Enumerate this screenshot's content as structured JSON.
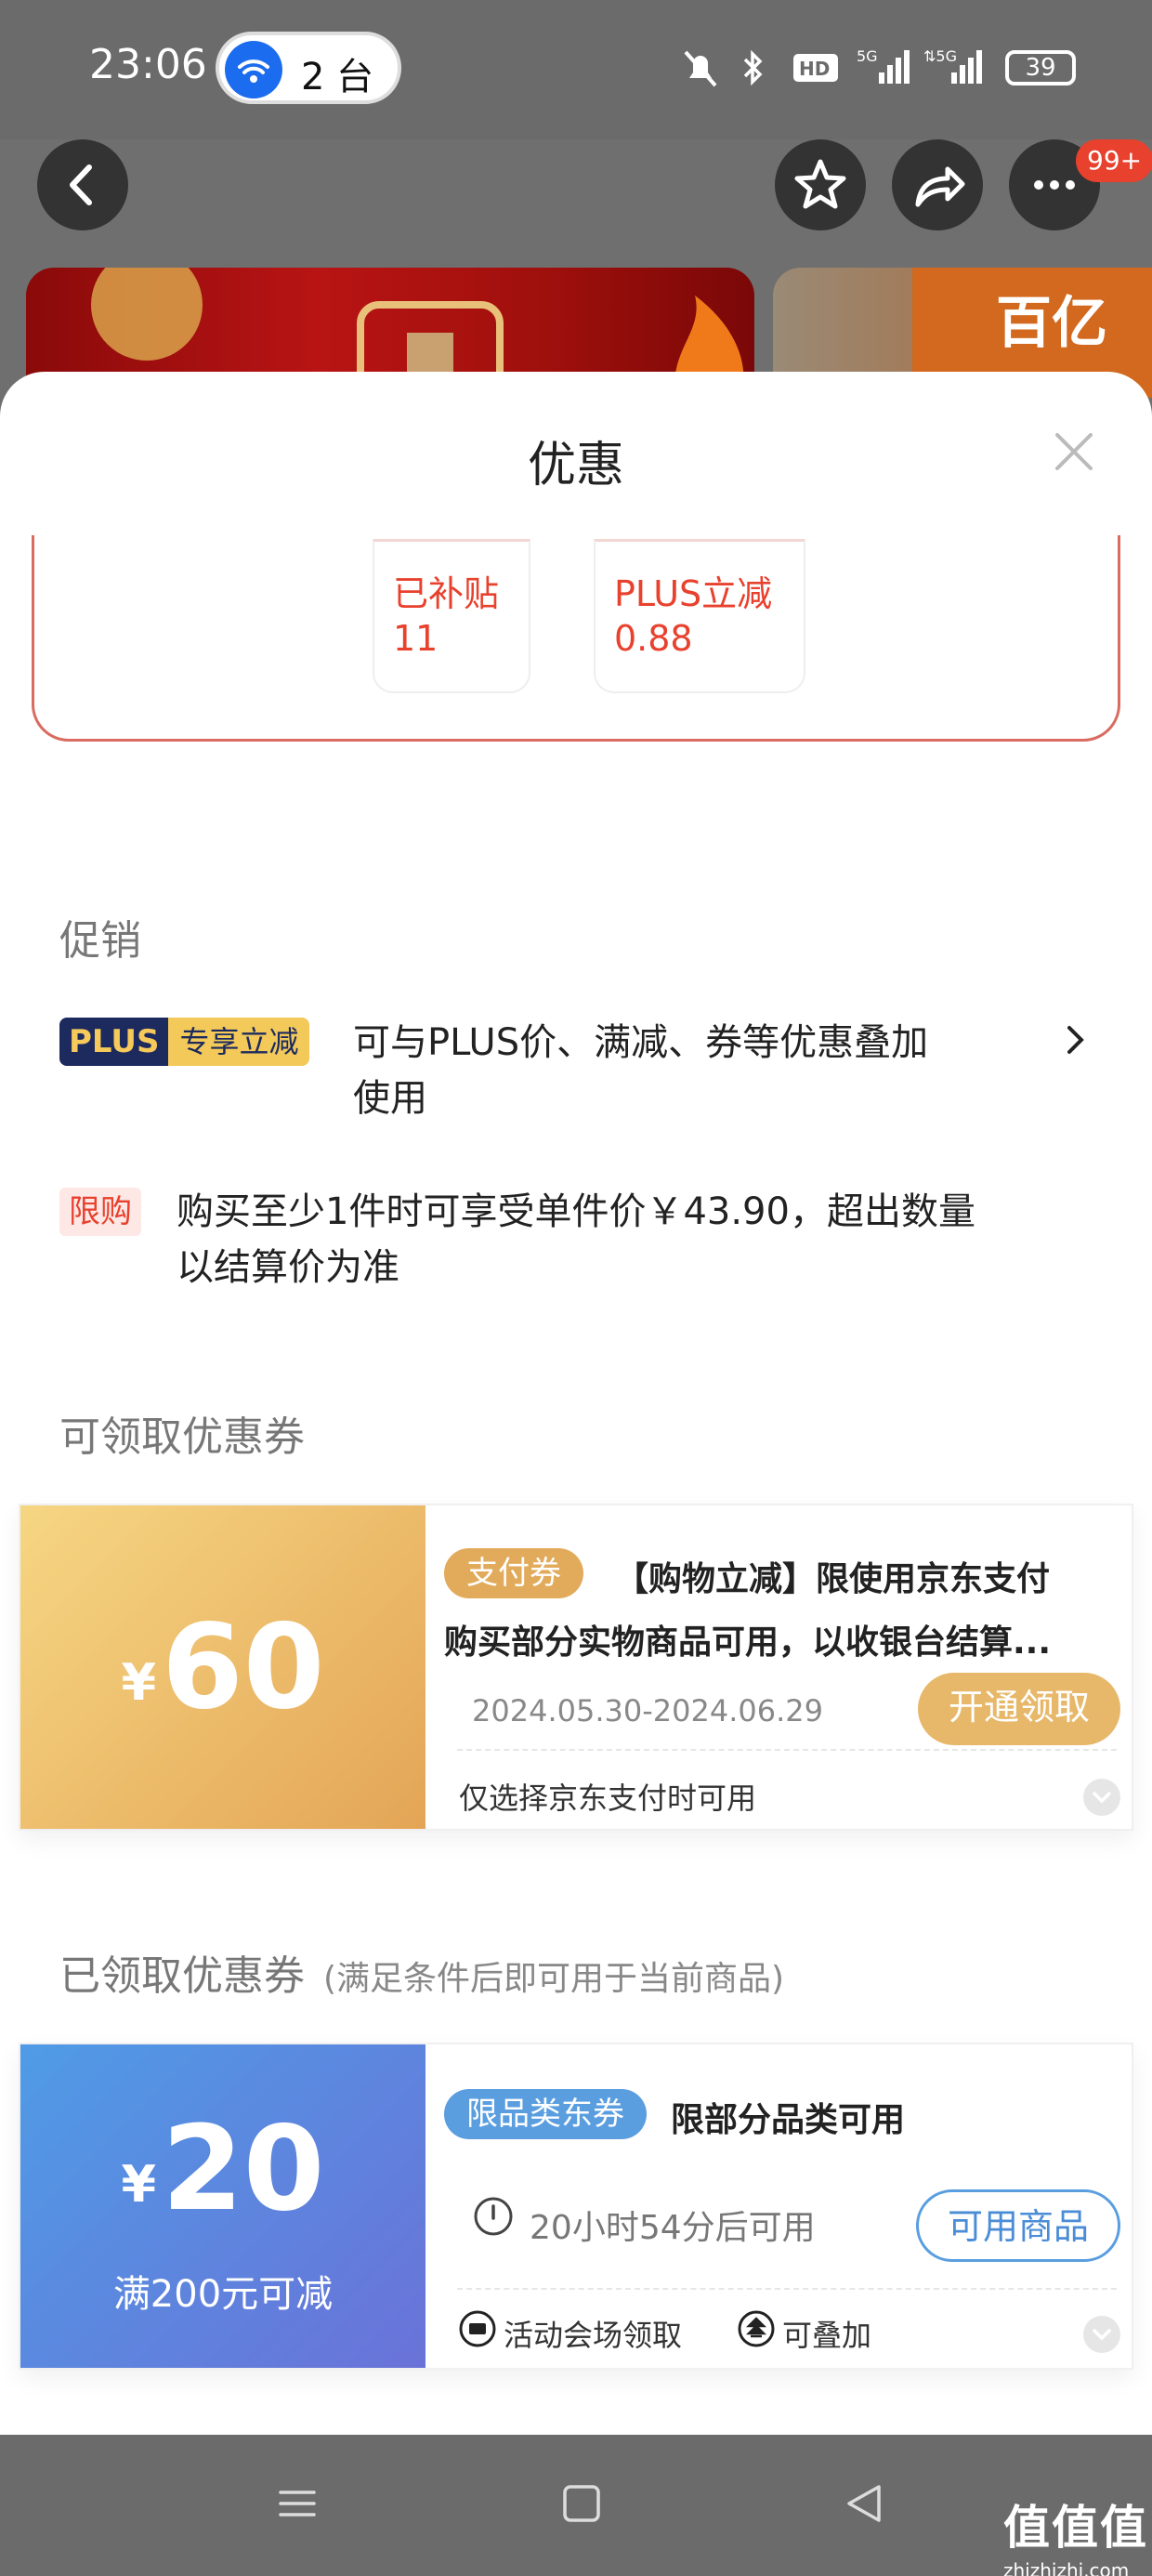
{
  "status_bar": {
    "time": "23:06",
    "hotspot_label": "2 台",
    "battery": "39"
  },
  "header": {
    "more_badge": "99+"
  },
  "sheet": {
    "title": "优惠",
    "price_chips": [
      {
        "line1": "已补贴",
        "line2": "11"
      },
      {
        "line1": "PLUS立减",
        "line2": "0.88"
      }
    ]
  },
  "promotions": {
    "heading": "促销",
    "plus": {
      "tag_a": "PLUS",
      "tag_b": "专享立减",
      "line1": "可与PLUS价、满减、券等优惠叠加",
      "line2": "使用"
    },
    "limit": {
      "tag": "限购",
      "line1": "购买至少1件时可享受单件价￥43.90，超出数量",
      "line2": "以结算价为准"
    }
  },
  "available_coupons": {
    "heading": "可领取优惠券",
    "items": [
      {
        "yen": "¥",
        "amount": "60",
        "tag": "支付券",
        "title": "【购物立减】限使用京东支付",
        "desc": "购买部分实物商品可用，以收银台结算...",
        "date": "2024.05.30-2024.06.29",
        "action": "开通领取",
        "footer": "仅选择京东支付时可用"
      }
    ]
  },
  "claimed_coupons": {
    "heading": "已领取优惠券",
    "subheading": "(满足条件后即可用于当前商品)",
    "items": [
      {
        "yen": "¥",
        "amount": "20",
        "condition": "满200元可减",
        "tag": "限品类东券",
        "title": "限部分品类可用",
        "time_prefix": "20",
        "time_unit1": "小时",
        "time_mid": "54",
        "time_suffix": "分后可用",
        "action": "可用商品",
        "footer_left": "活动会场领取",
        "footer_right": "可叠加"
      }
    ]
  },
  "watermark": {
    "big": "值值值",
    "small": "zhizhizhi.com"
  },
  "colors": {
    "accent_red": "#e8412d",
    "gold_coupon_start": "#f5d27a",
    "gold_coupon_end": "#e3a556",
    "blue_coupon_start": "#4f9be6",
    "blue_coupon_end": "#6a72d8"
  }
}
